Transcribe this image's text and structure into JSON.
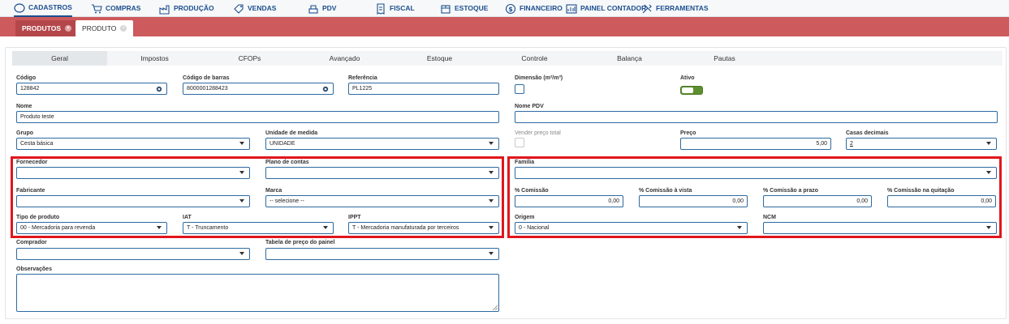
{
  "topnav": {
    "items": [
      {
        "label": "CADASTROS",
        "icon": "circle-icon"
      },
      {
        "label": "COMPRAS",
        "icon": "cart-icon"
      },
      {
        "label": "PRODUÇÃO",
        "icon": "factory-icon"
      },
      {
        "label": "VENDAS",
        "icon": "tag-icon"
      },
      {
        "label": "PDV",
        "icon": "pos-icon"
      },
      {
        "label": "FISCAL",
        "icon": "receipt-icon"
      },
      {
        "label": "ESTOQUE",
        "icon": "box-icon"
      },
      {
        "label": "FINANCEIRO",
        "icon": "dollar-icon"
      },
      {
        "label": "PAINEL CONTADOR",
        "icon": "dashboard-icon"
      },
      {
        "label": "FERRAMENTAS",
        "icon": "tools-icon"
      }
    ]
  },
  "doc_tabs": [
    {
      "label": "PRODUTOS",
      "state": "inactive"
    },
    {
      "label": "PRODUTO",
      "state": "current"
    }
  ],
  "subtabs": [
    "Geral",
    "Impostos",
    "CFOPs",
    "Avançado",
    "Estoque",
    "Controle",
    "Balança",
    "Pautas"
  ],
  "form": {
    "codigo": {
      "label": "Código",
      "value": "128842"
    },
    "codigo_barras": {
      "label": "Código de barras",
      "value": "8000001288423"
    },
    "referencia": {
      "label": "Referência",
      "value": "PL1225"
    },
    "dimensao": {
      "label": "Dimensão (m²/m³)"
    },
    "ativo": {
      "label": "Ativo",
      "checked": true
    },
    "nome": {
      "label": "Nome",
      "value": "Produto teste"
    },
    "nome_pdv": {
      "label": "Nome PDV",
      "value": ""
    },
    "grupo": {
      "label": "Grupo",
      "value": "Cesta básica"
    },
    "unidade": {
      "label": "Unidade de medida",
      "value": "UNIDADE"
    },
    "vender_preco_total": {
      "label": "Vender preço total"
    },
    "preco": {
      "label": "Preço",
      "value": "5,00"
    },
    "casas_decimais": {
      "label": "Casas decimais",
      "value": "2"
    },
    "fornecedor": {
      "label": "Fornecedor",
      "value": ""
    },
    "plano_contas": {
      "label": "Plano de contas",
      "value": ""
    },
    "familia": {
      "label": "Família",
      "value": ""
    },
    "fabricante": {
      "label": "Fabricante",
      "value": ""
    },
    "marca": {
      "label": "Marca",
      "value": "-- selecione --"
    },
    "comissao": {
      "label": "% Comissão",
      "value": "0,00"
    },
    "comissao_vista": {
      "label": "% Comissão à vista",
      "value": "0,00"
    },
    "comissao_prazo": {
      "label": "% Comissão a prazo",
      "value": "0,00"
    },
    "comissao_quitacao": {
      "label": "% Comissão na quitação",
      "value": "0,00"
    },
    "tipo_produto": {
      "label": "Tipo de produto",
      "value": "00 - Mercadoria para revenda"
    },
    "iat": {
      "label": "IAT",
      "value": "T - Truncamento"
    },
    "ippt": {
      "label": "IPPT",
      "value": "T - Mercadoria manufaturada por terceiros"
    },
    "origem": {
      "label": "Origem",
      "value": "0 - Nacional"
    },
    "ncm": {
      "label": "NCM",
      "value": ""
    },
    "comprador": {
      "label": "Comprador",
      "value": ""
    },
    "tabela_preco": {
      "label": "Tabela de preço do painel",
      "value": ""
    },
    "observacoes": {
      "label": "Observações",
      "value": ""
    }
  },
  "colors": {
    "nav_text": "#1c4f8f",
    "tabbar_bg": "#cd5a5d",
    "field_border": "#2d6aa1",
    "toggle_on": "#5d8e2f",
    "highlight": "#e0161b"
  }
}
